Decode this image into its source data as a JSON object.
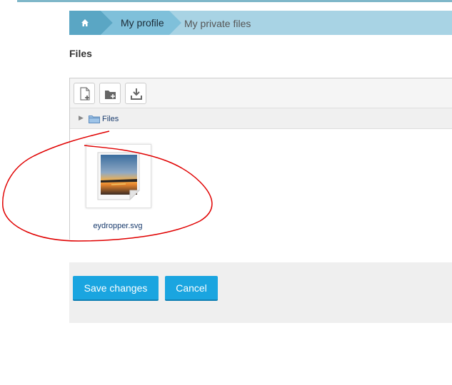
{
  "breadcrumb": {
    "home_icon": "home-icon",
    "items": [
      {
        "label": "My profile"
      },
      {
        "label": "My private files"
      }
    ]
  },
  "section": {
    "title": "Files"
  },
  "filemanager": {
    "toolbar": {
      "buttons": [
        {
          "icon": "add-file-icon"
        },
        {
          "icon": "create-folder-icon"
        },
        {
          "icon": "download-icon"
        }
      ]
    },
    "path": {
      "label": "Files",
      "icon": "folder-icon"
    },
    "files": [
      {
        "name": "eydropper.svg",
        "icon": "image-file-icon"
      }
    ]
  },
  "form": {
    "save_label": "Save changes",
    "cancel_label": "Cancel"
  },
  "colors": {
    "primary_button": "#1aa5e0",
    "breadcrumb_active": "#7fc0da",
    "breadcrumb_home": "#5aa6c4",
    "annotation": "#e00000"
  }
}
